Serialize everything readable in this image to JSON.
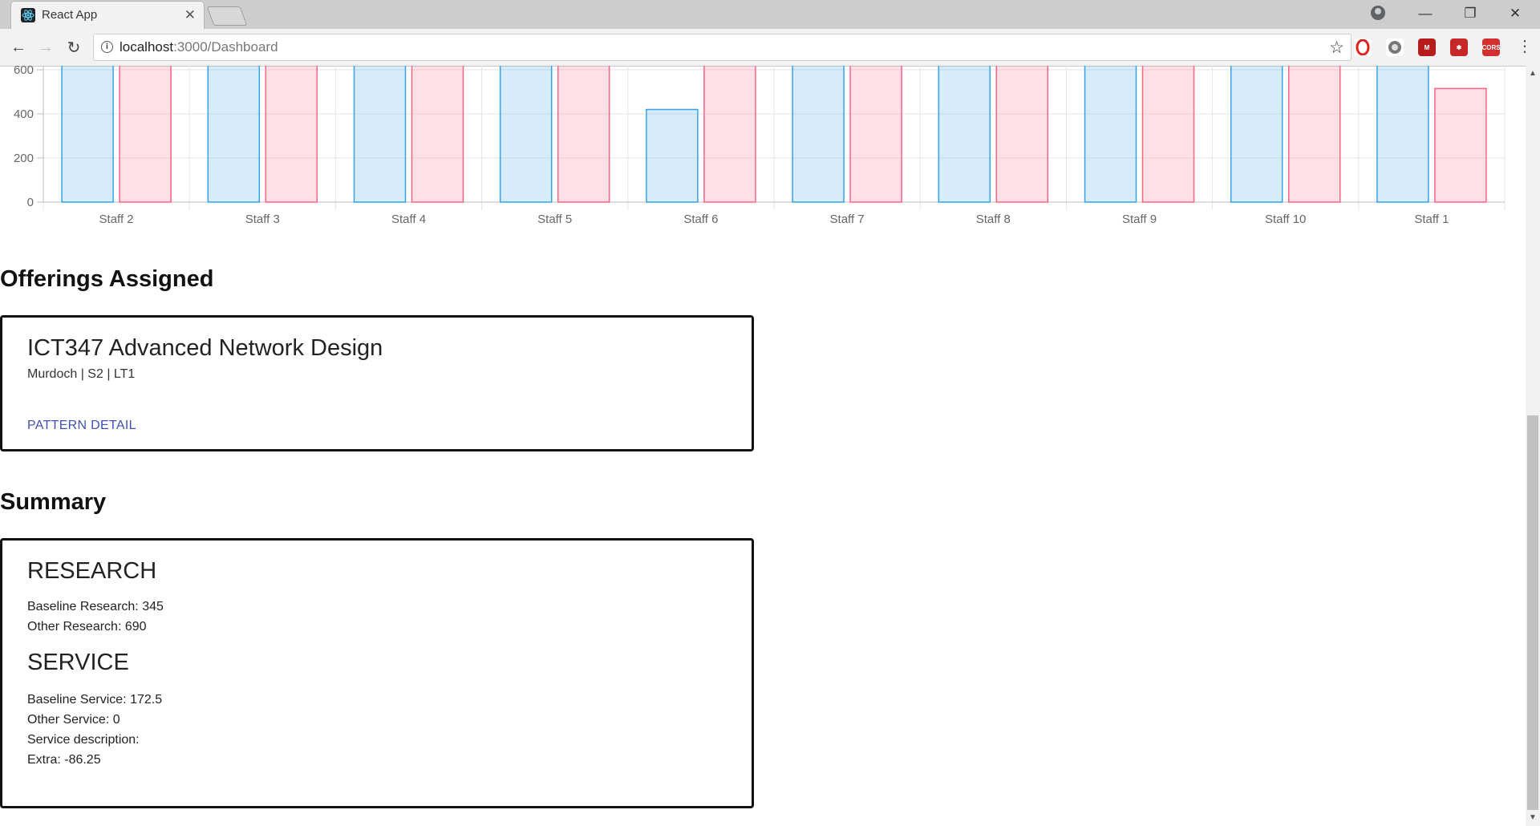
{
  "browser": {
    "tab_title": "React App",
    "url_host": "localhost",
    "url_path": ":3000/Dashboard"
  },
  "chart_data": {
    "type": "bar",
    "categories": [
      "Staff 2",
      "Staff 3",
      "Staff 4",
      "Staff 5",
      "Staff 6",
      "Staff 7",
      "Staff 8",
      "Staff 9",
      "Staff 10",
      "Staff 1"
    ],
    "series": [
      {
        "color": "#36a2eb",
        "values": [
          640,
          640,
          640,
          640,
          420,
          640,
          640,
          640,
          640,
          640
        ]
      },
      {
        "color": "#ff6384",
        "values": [
          640,
          640,
          640,
          640,
          640,
          640,
          640,
          640,
          640,
          515
        ]
      }
    ],
    "yticks": [
      "600",
      "400",
      "200",
      "0"
    ],
    "ylim": [
      0,
      640
    ],
    "grid": true
  },
  "offerings": {
    "heading": "Offerings Assigned",
    "items": [
      {
        "title": "ICT347 Advanced Network Design",
        "subtitle": "Murdoch | S2 | LT1",
        "link": "PATTERN DETAIL"
      }
    ]
  },
  "summary": {
    "heading": "Summary",
    "research": {
      "title": "RESEARCH",
      "baseline": "Baseline Research: 345",
      "other": "Other Research: 690"
    },
    "service": {
      "title": "SERVICE",
      "baseline": "Baseline Service: 172.5",
      "other": "Other Service: 0",
      "description": "Service description:",
      "extra": "Extra: -86.25"
    }
  },
  "icons": [
    "react-logo-icon",
    "close-icon",
    "profile-icon",
    "minimize-icon",
    "maximize-icon",
    "window-close-icon",
    "back-icon",
    "forward-icon",
    "reload-icon",
    "info-icon",
    "star-icon",
    "menu-icon"
  ]
}
